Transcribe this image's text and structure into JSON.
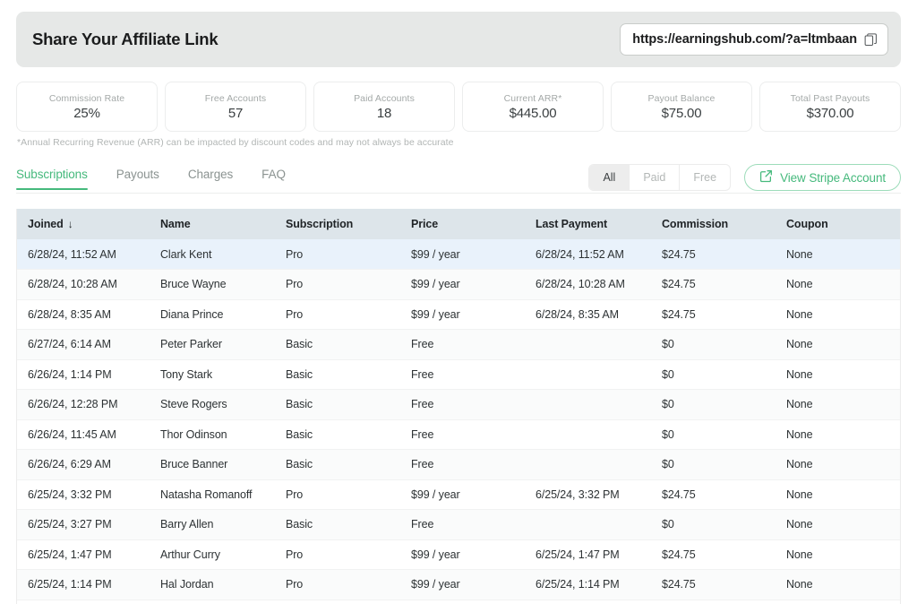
{
  "banner": {
    "title": "Share Your Affiliate Link",
    "url": "https://earningshub.com/?a=ltmbaan",
    "copy_icon": "copy-icon"
  },
  "stats": [
    {
      "label": "Commission Rate",
      "value": "25%"
    },
    {
      "label": "Free Accounts",
      "value": "57"
    },
    {
      "label": "Paid Accounts",
      "value": "18"
    },
    {
      "label": "Current ARR*",
      "value": "$445.00"
    },
    {
      "label": "Payout Balance",
      "value": "$75.00"
    },
    {
      "label": "Total Past Payouts",
      "value": "$370.00"
    }
  ],
  "footnote": "*Annual Recurring Revenue (ARR) can be impacted by discount codes and may not always be accurate",
  "tabs": [
    {
      "label": "Subscriptions",
      "active": true
    },
    {
      "label": "Payouts",
      "active": false
    },
    {
      "label": "Charges",
      "active": false
    },
    {
      "label": "FAQ",
      "active": false
    }
  ],
  "filters": [
    {
      "label": "All",
      "selected": true
    },
    {
      "label": "Paid",
      "selected": false
    },
    {
      "label": "Free",
      "selected": false
    }
  ],
  "stripe_button": {
    "label": "View Stripe Account",
    "icon": "external-link-icon"
  },
  "table": {
    "sort_column": "Joined",
    "sort_direction": "descending",
    "sort_arrow": "↓",
    "columns": [
      "Joined",
      "Name",
      "Subscription",
      "Price",
      "Last Payment",
      "Commission",
      "Coupon"
    ],
    "rows": [
      {
        "joined": "6/28/24, 11:52 AM",
        "name": "Clark Kent",
        "subscription": "Pro",
        "price": "$99 / year",
        "last_payment": "6/28/24, 11:52 AM",
        "commission": "$24.75",
        "coupon": "None",
        "highlight": true
      },
      {
        "joined": "6/28/24, 10:28 AM",
        "name": "Bruce Wayne",
        "subscription": "Pro",
        "price": "$99 / year",
        "last_payment": "6/28/24, 10:28 AM",
        "commission": "$24.75",
        "coupon": "None",
        "highlight": false
      },
      {
        "joined": "6/28/24, 8:35 AM",
        "name": "Diana Prince",
        "subscription": "Pro",
        "price": "$99 / year",
        "last_payment": "6/28/24, 8:35 AM",
        "commission": "$24.75",
        "coupon": "None",
        "highlight": false
      },
      {
        "joined": "6/27/24, 6:14 AM",
        "name": "Peter Parker",
        "subscription": "Basic",
        "price": "Free",
        "last_payment": "",
        "commission": "$0",
        "coupon": "None",
        "highlight": false
      },
      {
        "joined": "6/26/24, 1:14 PM",
        "name": "Tony Stark",
        "subscription": "Basic",
        "price": "Free",
        "last_payment": "",
        "commission": "$0",
        "coupon": "None",
        "highlight": false
      },
      {
        "joined": "6/26/24, 12:28 PM",
        "name": "Steve Rogers",
        "subscription": "Basic",
        "price": "Free",
        "last_payment": "",
        "commission": "$0",
        "coupon": "None",
        "highlight": false
      },
      {
        "joined": "6/26/24, 11:45 AM",
        "name": "Thor Odinson",
        "subscription": "Basic",
        "price": "Free",
        "last_payment": "",
        "commission": "$0",
        "coupon": "None",
        "highlight": false
      },
      {
        "joined": "6/26/24, 6:29 AM",
        "name": "Bruce Banner",
        "subscription": "Basic",
        "price": "Free",
        "last_payment": "",
        "commission": "$0",
        "coupon": "None",
        "highlight": false
      },
      {
        "joined": "6/25/24, 3:32 PM",
        "name": "Natasha Romanoff",
        "subscription": "Pro",
        "price": "$99 / year",
        "last_payment": "6/25/24, 3:32 PM",
        "commission": "$24.75",
        "coupon": "None",
        "highlight": false
      },
      {
        "joined": "6/25/24, 3:27 PM",
        "name": "Barry Allen",
        "subscription": "Basic",
        "price": "Free",
        "last_payment": "",
        "commission": "$0",
        "coupon": "None",
        "highlight": false
      },
      {
        "joined": "6/25/24, 1:47 PM",
        "name": "Arthur Curry",
        "subscription": "Pro",
        "price": "$99 / year",
        "last_payment": "6/25/24, 1:47 PM",
        "commission": "$24.75",
        "coupon": "None",
        "highlight": false
      },
      {
        "joined": "6/25/24, 1:14 PM",
        "name": "Hal Jordan",
        "subscription": "Pro",
        "price": "$99 / year",
        "last_payment": "6/25/24, 1:14 PM",
        "commission": "$24.75",
        "coupon": "None",
        "highlight": false
      }
    ]
  },
  "colors": {
    "accent_green": "#45b97c",
    "banner_bg": "#e6e8e7",
    "table_header_bg": "#dde5ea",
    "row_highlight": "#e9f2fb",
    "row_alt": "#fafbfb"
  }
}
